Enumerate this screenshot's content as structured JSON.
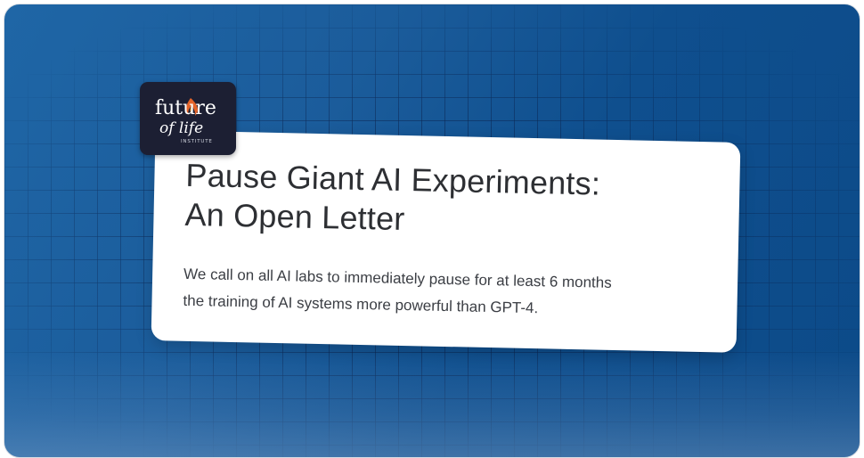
{
  "card": {
    "title_line_1": "Pause Giant AI Experiments:",
    "title_line_2": "An Open Letter",
    "body_line_1": "We call on all AI labs to immediately pause for at least 6 months",
    "body_line_2": "the training of AI systems more powerful than GPT-4."
  },
  "logo": {
    "text_top": "future",
    "text_mid": "of life",
    "text_small": "INSTITUTE",
    "icon": "flame-icon"
  },
  "colors": {
    "background_blue": "#1b5c9b",
    "grid_line": "#0a1e46",
    "card_bg": "#ffffff",
    "logo_bg": "#1c1f33",
    "flame": "#e4642a"
  }
}
